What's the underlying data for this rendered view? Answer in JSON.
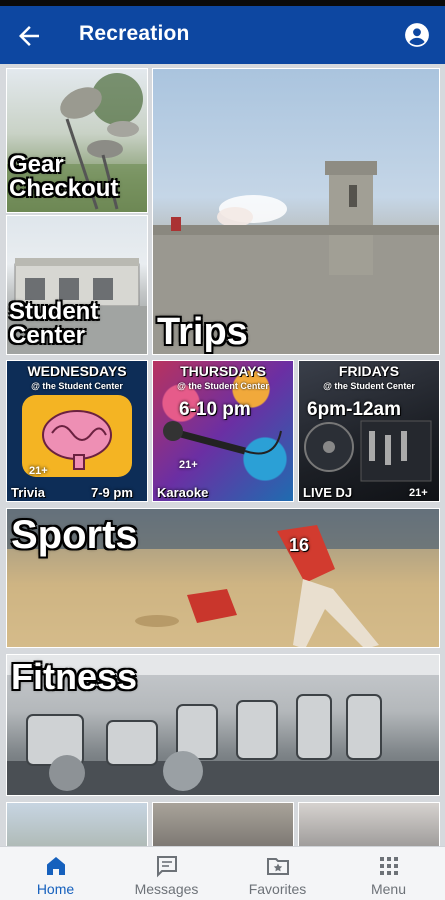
{
  "app_bar": {
    "title": "Recreation",
    "back_icon": "arrow-left-icon",
    "account_icon": "account-circle-icon",
    "color": "#0d47a1"
  },
  "tiles": {
    "gear_checkout": "Gear Checkout",
    "student_center": "Student Center",
    "trips": "Trips",
    "sports": "Sports",
    "fitness": "Fitness"
  },
  "events": {
    "wednesday": {
      "day": "WEDNESDAYS",
      "location": "@ the Student Center",
      "age": "21+",
      "name": "Trivia",
      "time": "7-9 pm"
    },
    "thursday": {
      "day": "THURSDAYS",
      "location": "@ the Student Center",
      "time": "6-10 pm",
      "age": "21+",
      "name": "Karaoke"
    },
    "friday": {
      "day": "FRIDAYS",
      "location": "@ the Student Center",
      "time": "6pm-12am",
      "name": "LIVE DJ",
      "age": "21+"
    }
  },
  "sports_jersey_number": "16",
  "bottom_nav": [
    {
      "label": "Home",
      "icon": "home-icon",
      "active": true
    },
    {
      "label": "Messages",
      "icon": "message-icon",
      "active": false
    },
    {
      "label": "Favorites",
      "icon": "favorites-folder-icon",
      "active": false
    },
    {
      "label": "Menu",
      "icon": "grid-menu-icon",
      "active": false
    }
  ],
  "accent_color": "#1560bd"
}
